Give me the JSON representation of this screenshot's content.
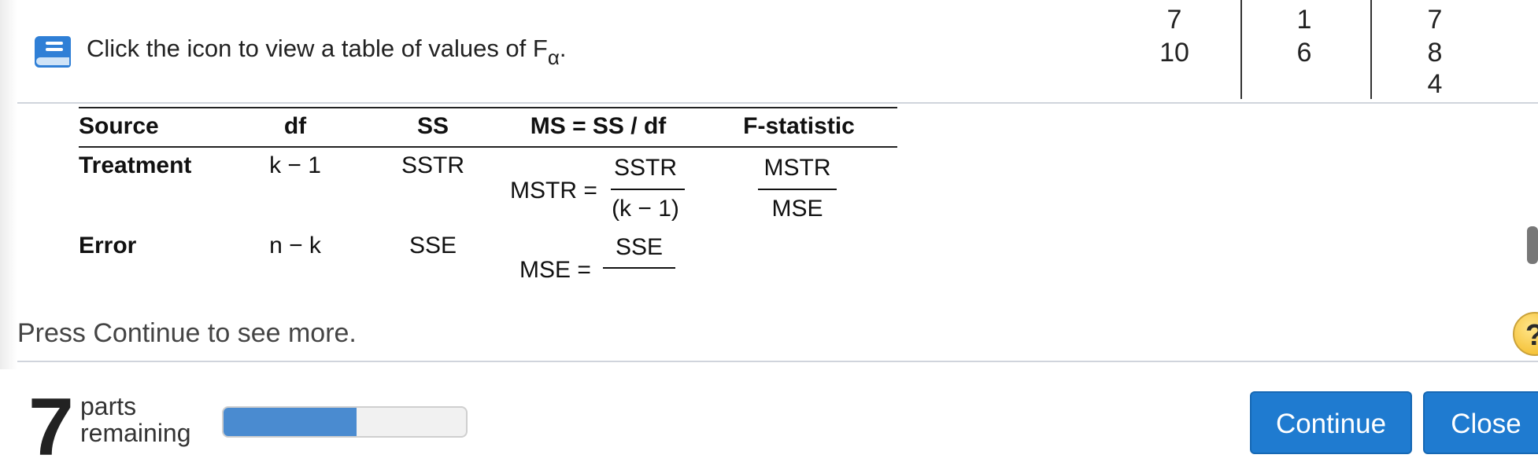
{
  "instruction": {
    "text": "Click the icon to view a table of values of F",
    "subscript": "α",
    "trail": "."
  },
  "data_grid": {
    "col1": [
      "7",
      "10"
    ],
    "col2": [
      "1",
      "6"
    ],
    "col3": [
      "7",
      "8",
      "4"
    ]
  },
  "anova_table": {
    "headers": [
      "Source",
      "df",
      "SS",
      "MS = SS / df",
      "F-statistic"
    ],
    "treatment": {
      "source": "Treatment",
      "df": "k − 1",
      "ss": "SSTR",
      "ms_lhs": "MSTR =",
      "ms_num": "SSTR",
      "ms_den": "(k − 1)",
      "f_num": "MSTR",
      "f_den": "MSE"
    },
    "error": {
      "source": "Error",
      "df": "n − k",
      "ss": "SSE",
      "ms_lhs": "MSE =",
      "ms_num": "SSE"
    }
  },
  "press_text": "Press Continue to see more.",
  "help_icon": "?",
  "footer": {
    "parts_count": "7",
    "parts_label_1": "parts",
    "parts_label_2": "remaining",
    "progress_fraction": 0.55,
    "continue_label": "Continue",
    "close_label": "Close"
  },
  "colors": {
    "accent": "#1f7bd0",
    "progress": "#4a8bd0",
    "help": "#f2b61c"
  }
}
